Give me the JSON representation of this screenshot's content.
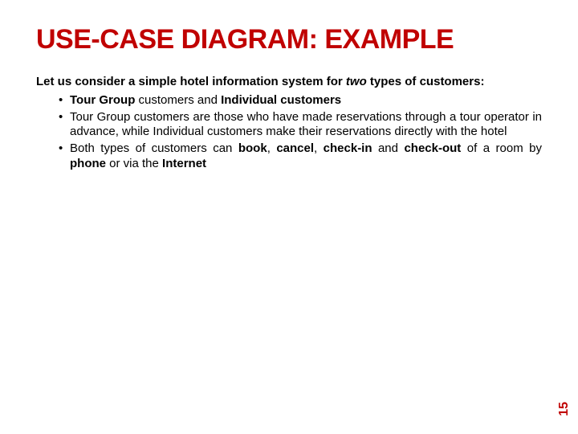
{
  "title": "USE-CASE DIAGRAM: EXAMPLE",
  "intro_pre": "Let us consider a simple hotel information system for ",
  "intro_em": "two",
  "intro_post": " types of customers:",
  "bullets": {
    "b1_a": "Tour Group ",
    "b1_b": "customers and ",
    "b1_c": "Individual customers",
    "b2": "Tour Group customers are those who have made reservations through a tour operator in advance, while Individual customers make their reservations directly with the hotel",
    "b3_a": "Both types of customers can ",
    "b3_b": "book",
    "b3_c": ", ",
    "b3_d": "cancel",
    "b3_e": ", ",
    "b3_f": "check-in",
    "b3_g": " and ",
    "b3_h": "check-out ",
    "b3_i": "of a room by ",
    "b3_j": "phone",
    "b3_k": " or via the ",
    "b3_l": "Internet"
  },
  "page_number": "15"
}
